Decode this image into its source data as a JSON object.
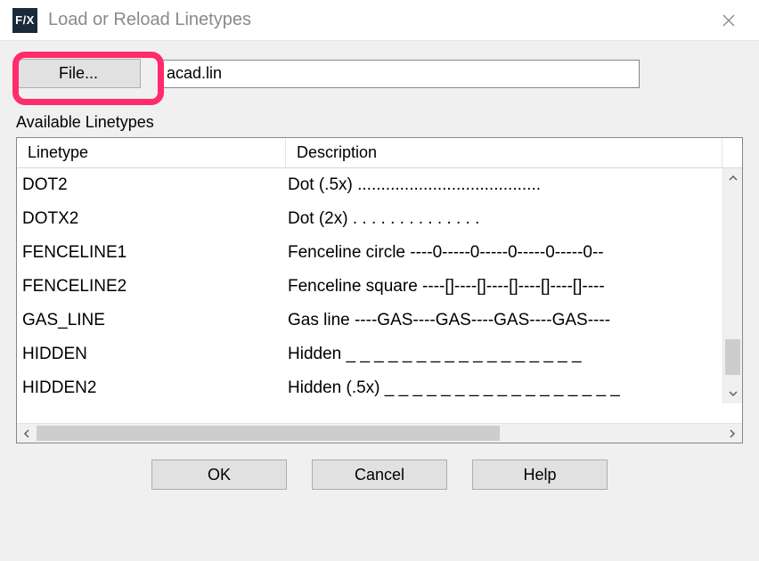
{
  "title": "Load or Reload Linetypes",
  "app_icon_text": "F/X",
  "file_button_label": "File...",
  "file_input_value": "acad.lin",
  "section_label": "Available Linetypes",
  "columns": {
    "linetype": "Linetype",
    "description": "Description"
  },
  "rows": [
    {
      "name": "DOT2",
      "desc": "Dot (.5x) ......................................."
    },
    {
      "name": "DOTX2",
      "desc": "Dot (2x) .  .  .  .  .  .  .  .  .  .  .  .  .  ."
    },
    {
      "name": "FENCELINE1",
      "desc": "Fenceline circle ----0-----0-----0-----0-----0--"
    },
    {
      "name": "FENCELINE2",
      "desc": "Fenceline square ----[]----[]----[]----[]----[]----"
    },
    {
      "name": "GAS_LINE",
      "desc": "Gas line ----GAS----GAS----GAS----GAS----"
    },
    {
      "name": "HIDDEN",
      "desc": "Hidden _ _ _ _ _ _ _ _ _ _ _ _ _ _ _ _ _"
    },
    {
      "name": "HIDDEN2",
      "desc": "Hidden (.5x) _ _ _ _ _ _ _ _ _ _ _ _ _ _ _ _ _"
    }
  ],
  "buttons": {
    "ok": "OK",
    "cancel": "Cancel",
    "help": "Help"
  }
}
